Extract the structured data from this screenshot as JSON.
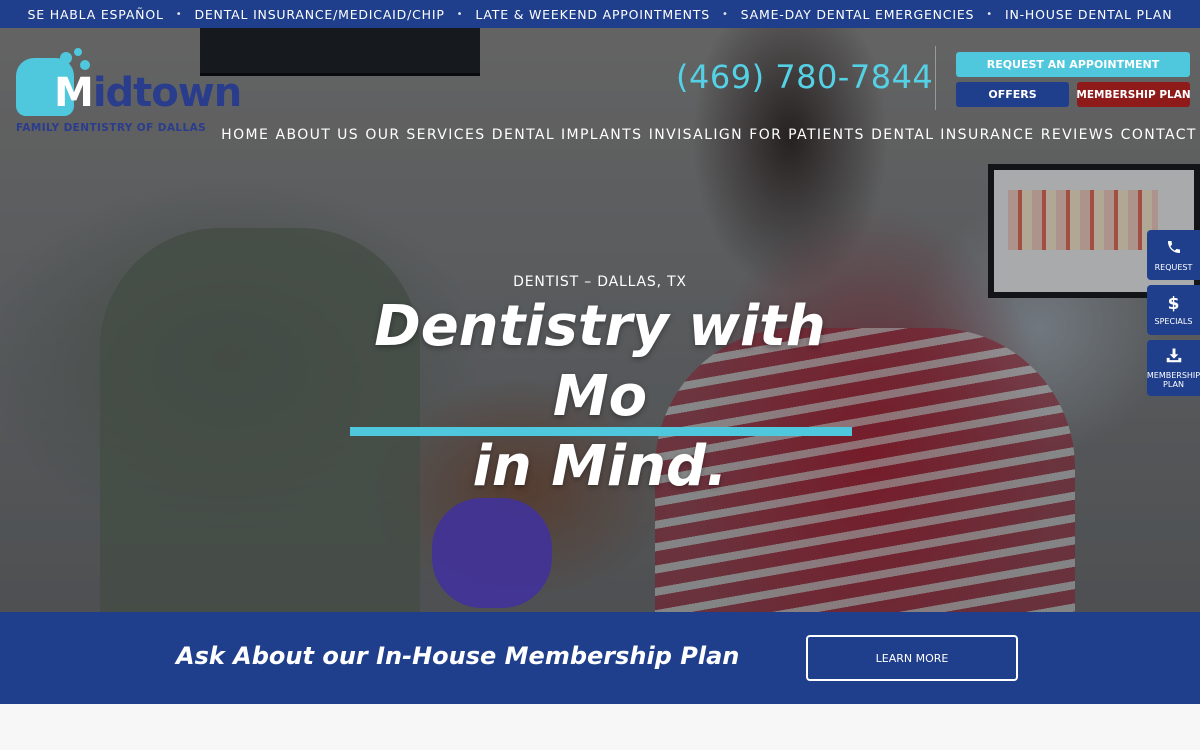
{
  "topbar": {
    "items": [
      "SE HABLA ESPAÑOL",
      "DENTAL INSURANCE/MEDICAID/CHIP",
      "LATE & WEEKEND APPOINTMENTS",
      "SAME-DAY DENTAL EMERGENCIES",
      "IN-HOUSE DENTAL PLAN"
    ],
    "separator": "•"
  },
  "logo": {
    "word_accent": "M",
    "word_rest": "idtown",
    "subtitle": "FAMILY DENTISTRY OF DALLAS"
  },
  "header": {
    "phone": "(469) 780-7844",
    "request_appointment": "REQUEST AN APPOINTMENT",
    "offers": "OFFERS",
    "membership_plan": "MEMBERSHIP PLAN"
  },
  "nav": {
    "items": [
      "HOME",
      "ABOUT US",
      "OUR SERVICES",
      "DENTAL IMPLANTS",
      "INVISALIGN",
      "FOR PATIENTS",
      "DENTAL INSURANCE",
      "REVIEWS",
      "CONTACT"
    ]
  },
  "hero": {
    "kicker": "DENTIST – DALLAS, TX",
    "headline_line1": "Dentistry with",
    "headline_line2": "Mo",
    "headline_line3": "in Mind."
  },
  "side_tabs": [
    {
      "icon": "phone-icon",
      "label": "REQUEST"
    },
    {
      "icon": "dollar-icon",
      "label": "SPECIALS"
    },
    {
      "icon": "download-icon",
      "label_line1": "MEMBERSHIP",
      "label_line2": "PLAN"
    }
  ],
  "band": {
    "title": "Ask About our In-House Membership Plan",
    "button": "LEARN MORE"
  },
  "colors": {
    "brand_blue": "#1f3f8c",
    "accent_cyan": "#4fc7dc",
    "membership_red": "#8e1a1a"
  }
}
